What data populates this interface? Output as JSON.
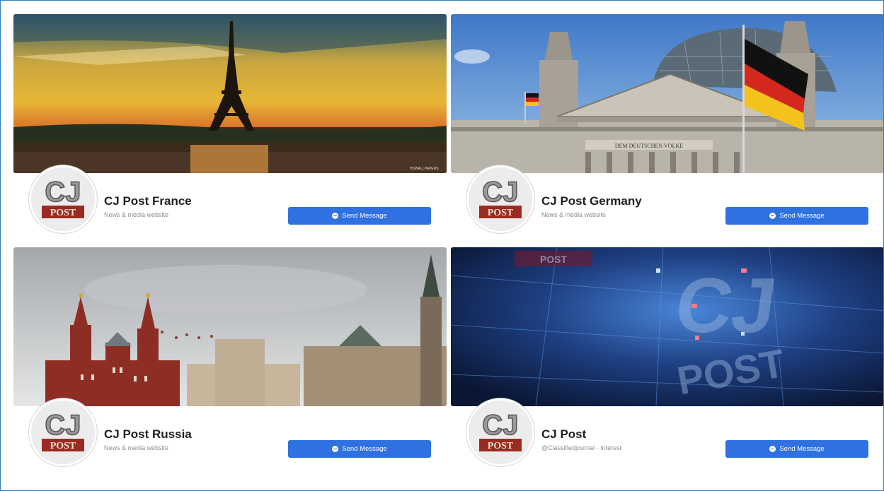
{
  "cards": [
    {
      "name": "CJ Post France",
      "subtitle": "News & media website",
      "button": "Send Message",
      "cover": "eiffel-tower-sunset"
    },
    {
      "name": "CJ Post Germany",
      "subtitle": "News & media website",
      "button": "Send Message",
      "cover": "reichstag-building-flag"
    },
    {
      "name": "CJ Post Russia",
      "subtitle": "News & media website",
      "button": "Send Message",
      "cover": "red-square-moscow"
    },
    {
      "name": "CJ Post",
      "subtitle": "@Classifiedjournal · Interest",
      "button": "Send Message",
      "cover": "cj-post-blue-tech"
    }
  ],
  "logo": {
    "top": "CJ",
    "bottom": "POST"
  },
  "cover_text": {
    "reichstag_inscription": "DEM DEUTSCHEN VOLKE",
    "watermark": "HDWALLPAPERS"
  },
  "icons": {
    "button": "message-icon"
  },
  "colors": {
    "button": "#2f71e0",
    "frame_border": "#2f7dc0"
  }
}
